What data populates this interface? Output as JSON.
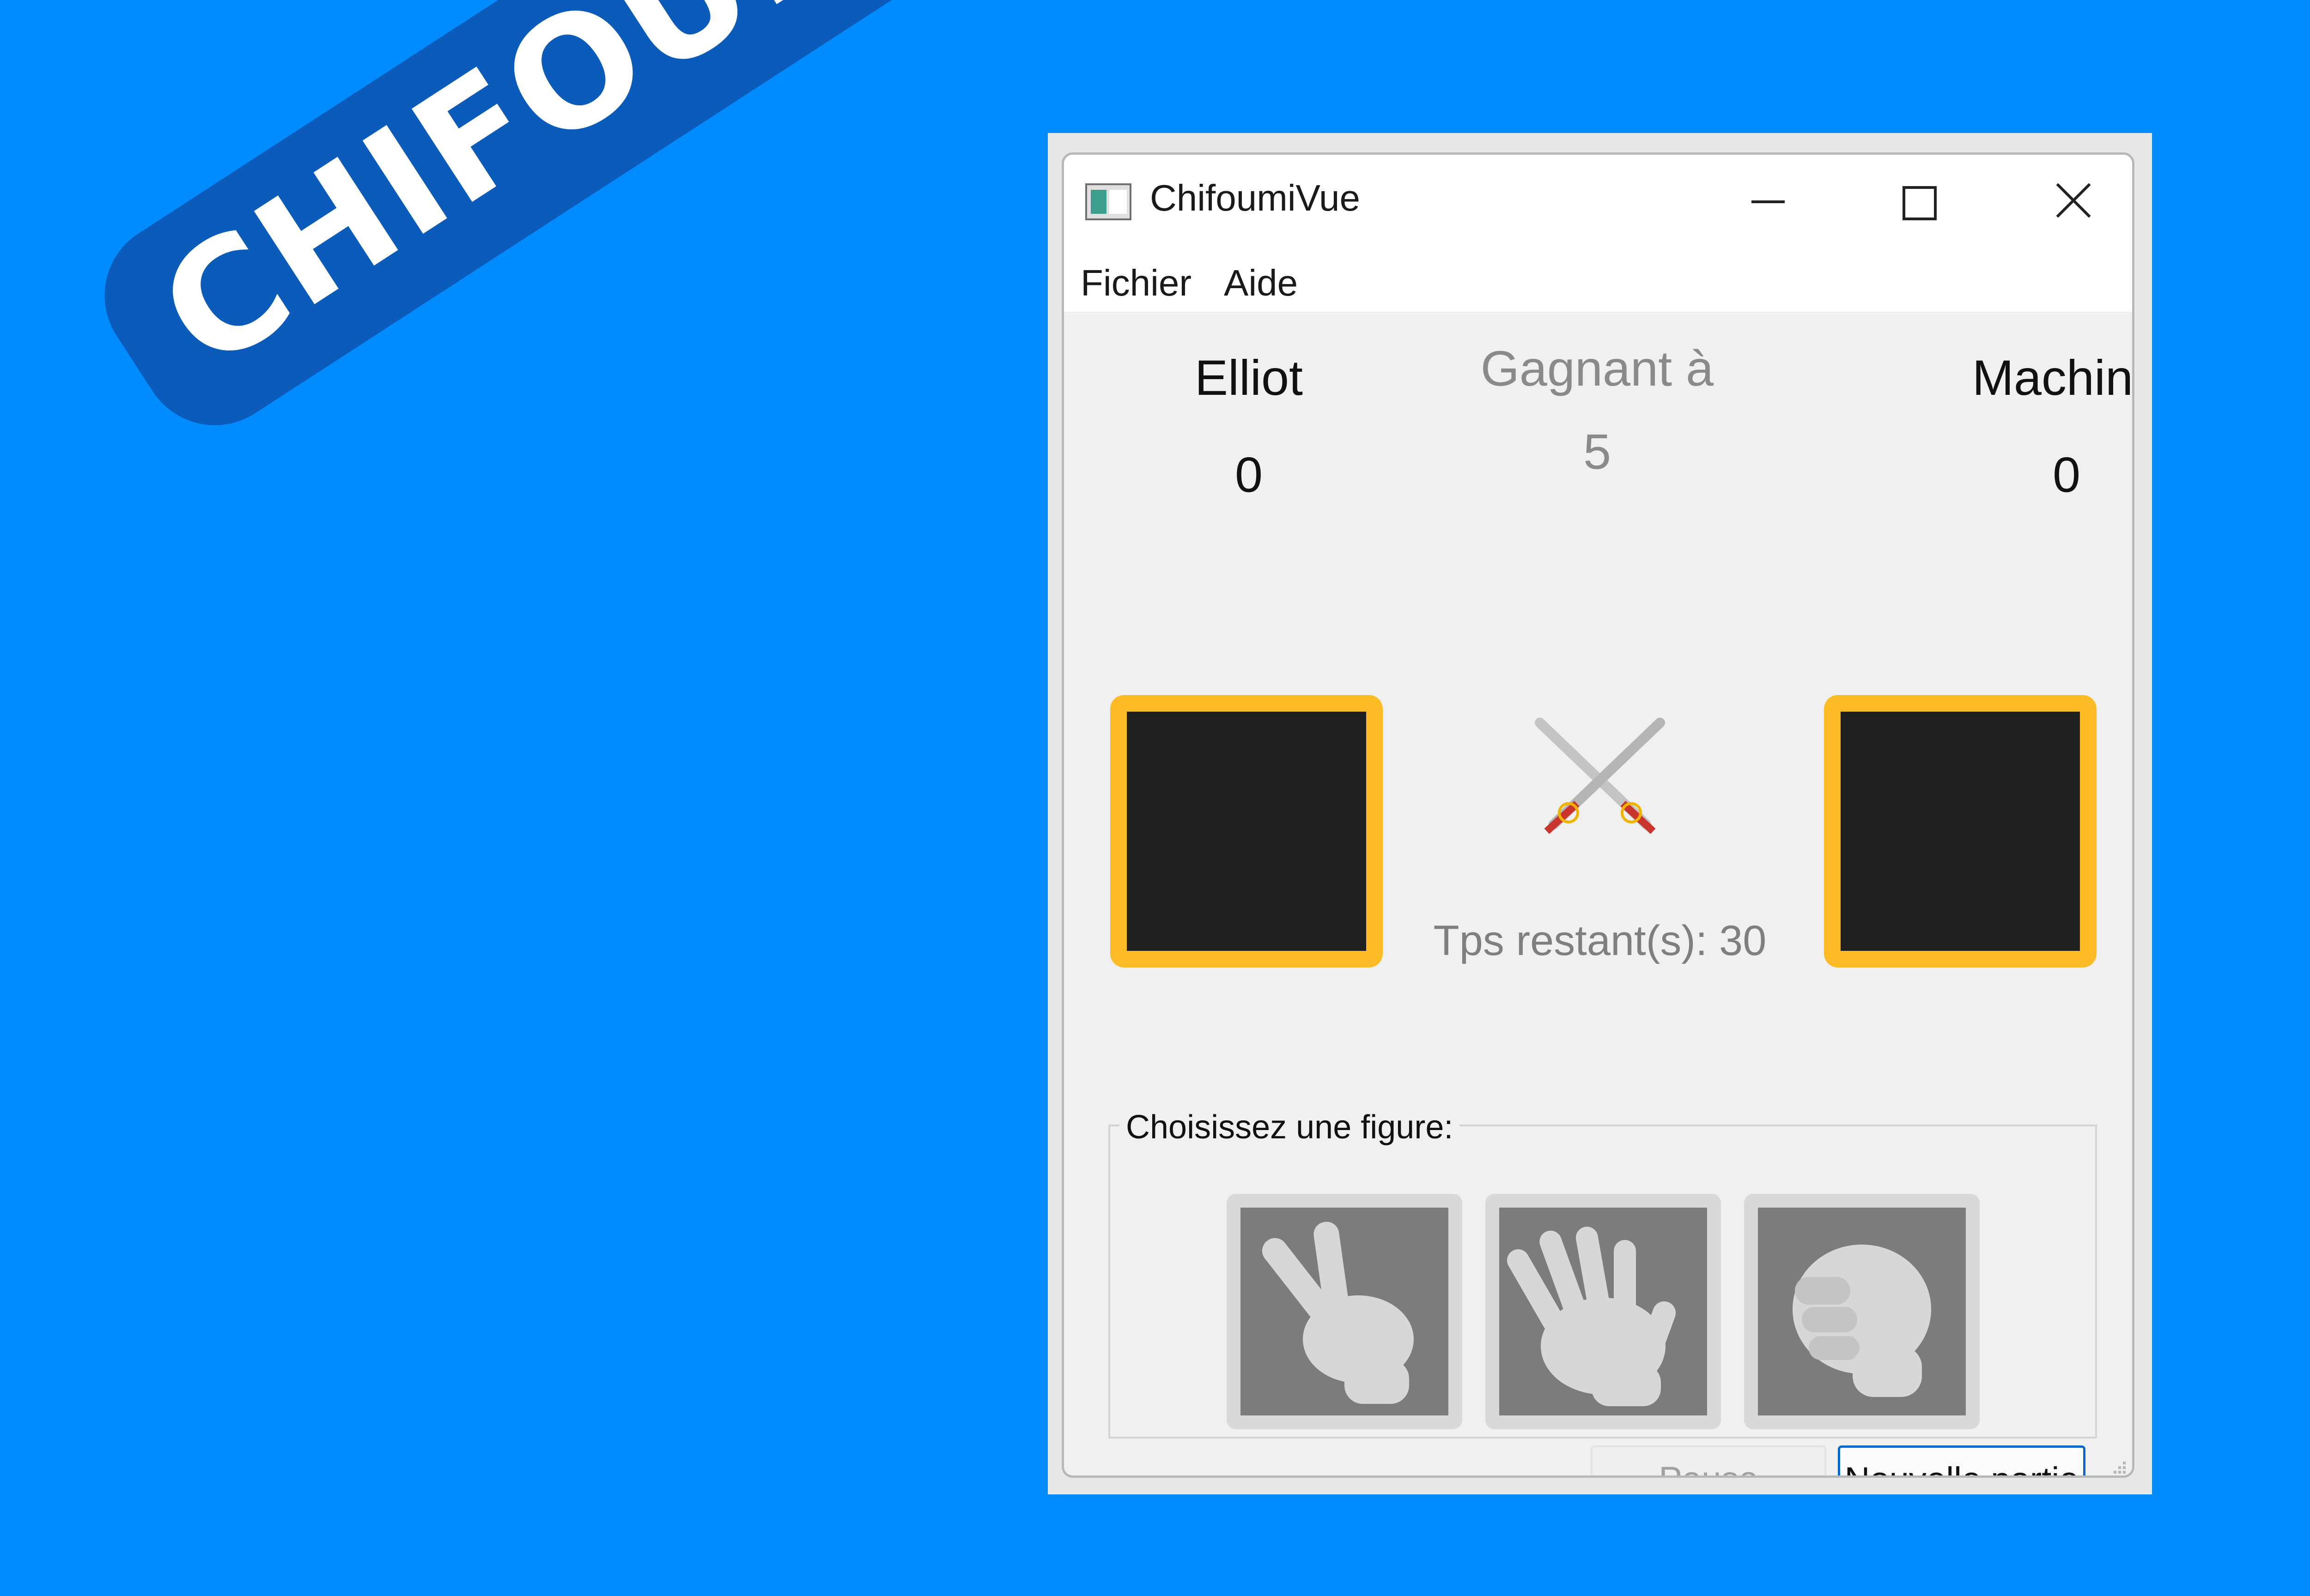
{
  "banner": {
    "text": "CHIFOUMI"
  },
  "window": {
    "title": "ChifoumiVue",
    "controls": [
      "minimize-icon",
      "maximize-icon",
      "close-icon"
    ]
  },
  "menu": {
    "items": [
      "Fichier",
      "Aide"
    ]
  },
  "game": {
    "player": {
      "name": "Elliot",
      "score": "0"
    },
    "machine": {
      "name": "Machine",
      "score": "0"
    },
    "winning": {
      "label": "Gagnant à",
      "value": "5"
    },
    "timer": {
      "label": "Tps restant(s):",
      "value": "30"
    }
  },
  "figures": {
    "label": "Choisissez une figure:",
    "items": [
      "scissors-hand-icon",
      "paper-hand-icon",
      "rock-fist-icon"
    ]
  },
  "buttons": {
    "pause": "Pause",
    "new_game": "Nouvelle partie"
  },
  "colors": {
    "background": "#008bff",
    "banner": "#0b5bbb",
    "frame": "#fdbc26",
    "accent": "#0b67c7"
  }
}
